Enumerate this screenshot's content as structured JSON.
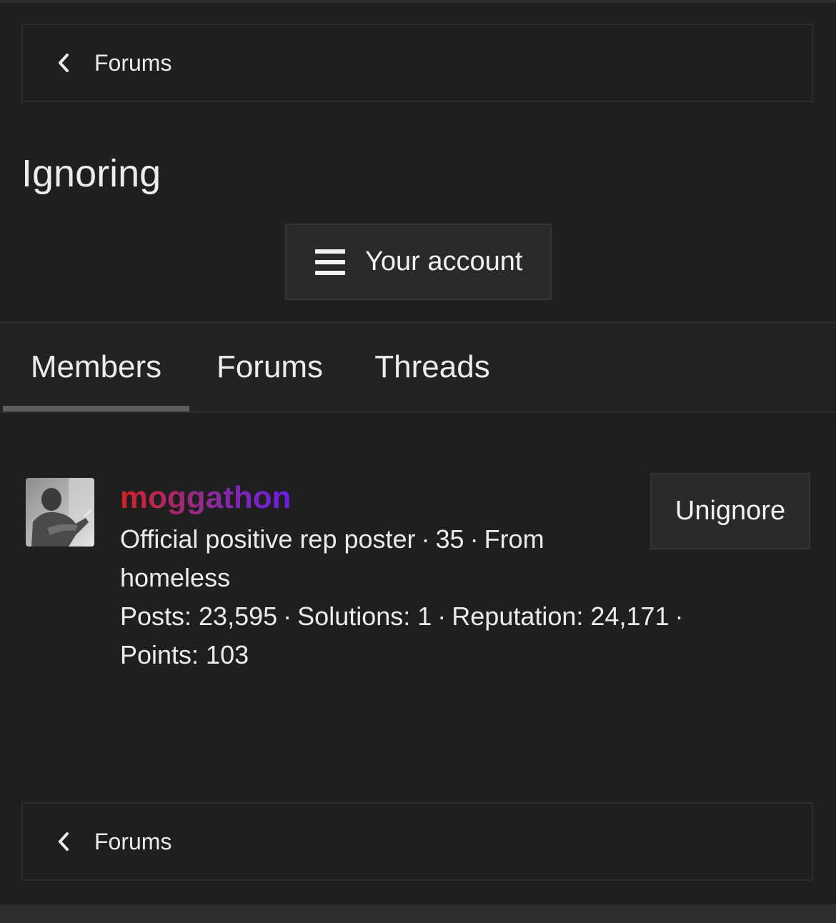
{
  "breadcrumb": {
    "label": "Forums",
    "icon": "chevron-left-icon"
  },
  "page": {
    "title": "Ignoring"
  },
  "account_menu": {
    "label": "Your account",
    "icon": "hamburger-menu-icon"
  },
  "tabs": [
    {
      "label": "Members",
      "active": true
    },
    {
      "label": "Forums",
      "active": false
    },
    {
      "label": "Threads",
      "active": false
    }
  ],
  "member": {
    "username": "moggathon",
    "user_title": "Official positive rep poster",
    "age": "35",
    "location": "From homeless",
    "stats": {
      "posts": "Posts: 23,595",
      "solutions": "Solutions: 1",
      "reputation": "Reputation: 24,171",
      "points": "Points: 103"
    },
    "unignore_label": "Unignore",
    "name_gradient": [
      "#d42222",
      "#6a1ee8"
    ]
  },
  "footer_breadcrumb": {
    "label": "Forums",
    "icon": "chevron-left-icon"
  },
  "colors": {
    "background": "#1f1f1f",
    "panel": "#2a2a2a",
    "text": "#ececec",
    "tab_underline": "#5f5f5f"
  }
}
